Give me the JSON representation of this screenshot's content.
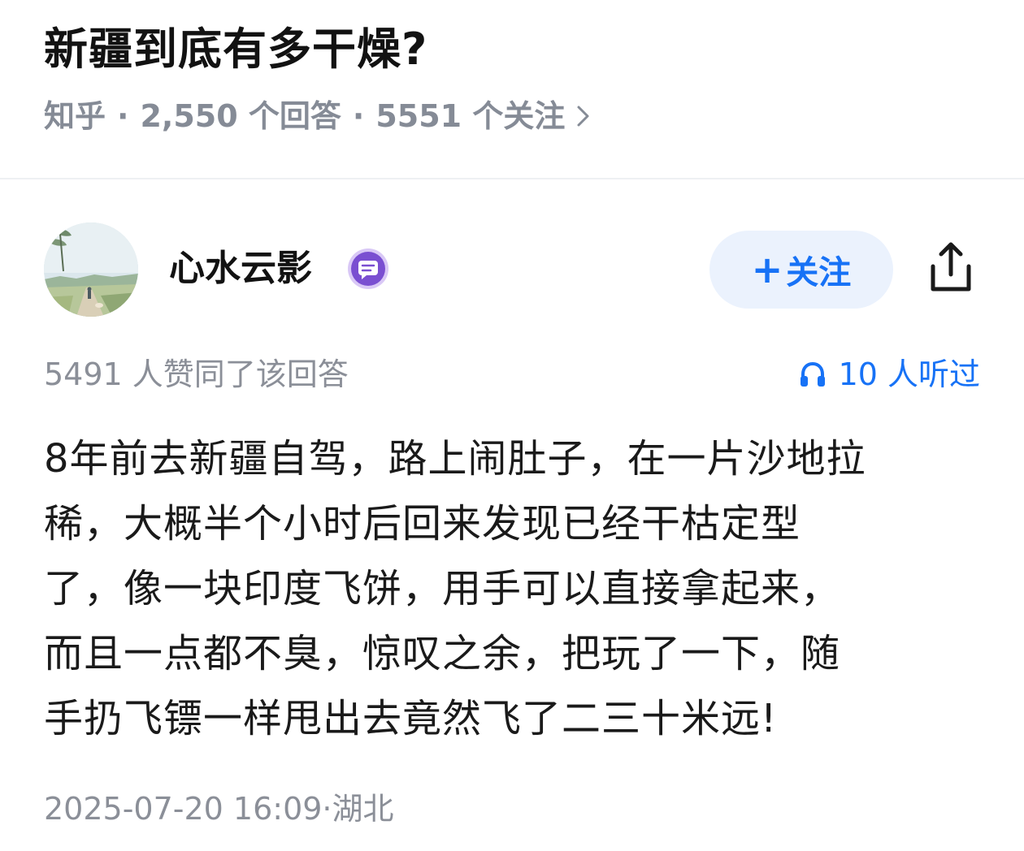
{
  "question": {
    "title": "新疆到底有多干燥?",
    "source": "知乎",
    "separator": "·",
    "answers": "2,550 个回答",
    "followers": "5551 个关注",
    "chevron_icon": "chevron-right-icon"
  },
  "author": {
    "name": "心水云影",
    "avatar_icon": "avatar-landscape",
    "badge_icon": "message-badge-icon",
    "follow_label": "关注",
    "follow_plus": "+",
    "share_icon": "share-icon"
  },
  "stats": {
    "upvotes": "5491 人赞同了该回答",
    "listened": "10 人听过",
    "listen_icon": "headphones-icon"
  },
  "answer": {
    "lines": [
      "8年前去新疆自驾，路上闹肚子，在一片沙地拉",
      "稀，大概半个小时后回来发现已经干枯定型",
      "了，像一块印度飞饼，用手可以直接拿起来，",
      "而且一点都不臭，惊叹之余，把玩了一下，随",
      "手扔飞镖一样甩出去竟然飞了二三十米远!"
    ],
    "timestamp": "2025-07-20 16:09·湖北"
  },
  "colors": {
    "accent": "#1772f6",
    "follow_bg": "#ebf2fd",
    "meta": "#858b96",
    "badge": "#7a4fd1"
  }
}
